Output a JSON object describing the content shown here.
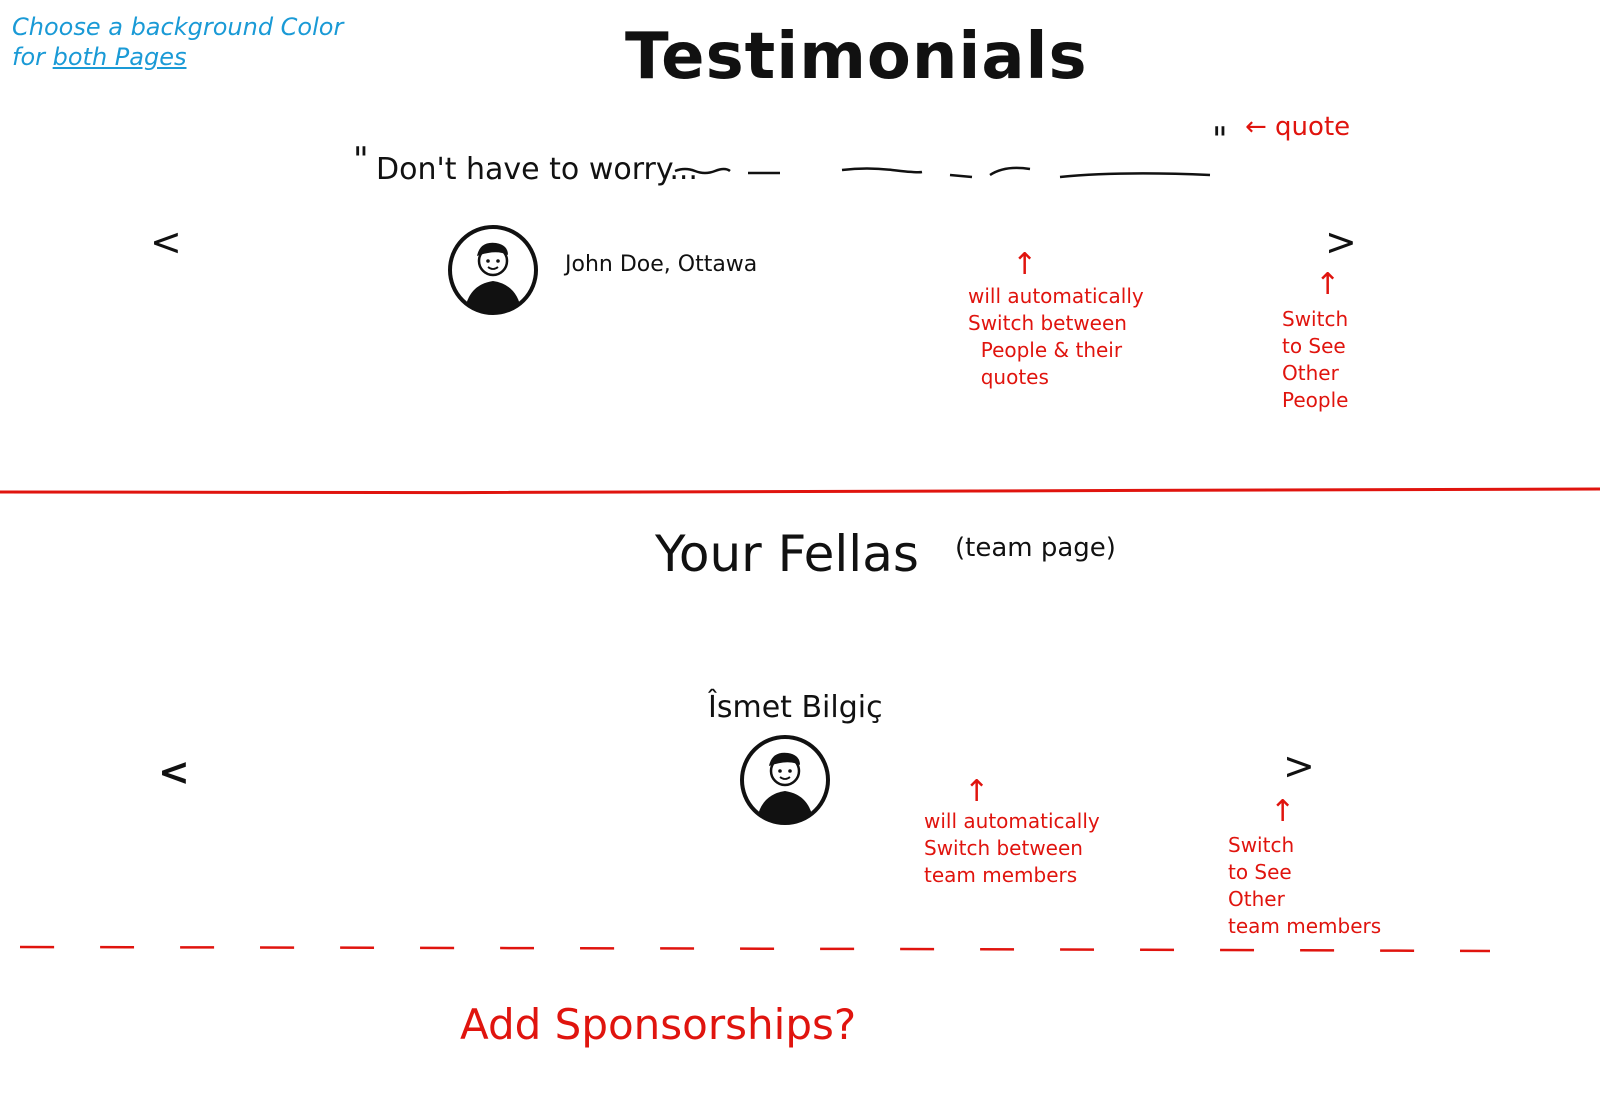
{
  "background_note": {
    "line1": "Choose a background Color",
    "line2_prefix": "for ",
    "line2_underlined": "both Pages",
    "color": "#1a9ad6"
  },
  "testimonials": {
    "title": "Testimonials",
    "quote_open": "\"",
    "quote_text": "Don't have to worry...",
    "quote_close": "\"",
    "quote_label": "← quote",
    "prev_arrow": "<",
    "next_arrow": ">",
    "person_name": "John Doe, Ottawa",
    "note_auto": "will automatically\nSwitch between\n  People & their\n  quotes",
    "note_switch": "Switch\nto See\nOther\nPeople",
    "up_arrow": "↑"
  },
  "team": {
    "title": "Your Fellas",
    "subtitle": "(team page)",
    "prev_arrow": "<",
    "next_arrow": ">",
    "member_name": "Îsmet Bilgiç",
    "note_auto": "will automatically\nSwitch between\nteam members",
    "note_switch": "Switch\nto See\nOther\nteam members",
    "up_arrow": "↑"
  },
  "sponsorships": {
    "label": "Add Sponsorships?"
  },
  "colors": {
    "ink": "#111111",
    "annotation": "#e0140e",
    "note_blue": "#1a9ad6",
    "background": "#ffffff"
  },
  "icons": {
    "avatar": "person-avatar-icon",
    "prev": "chevron-left-icon",
    "next": "chevron-right-icon",
    "annotation_arrow": "arrow-up-icon"
  }
}
